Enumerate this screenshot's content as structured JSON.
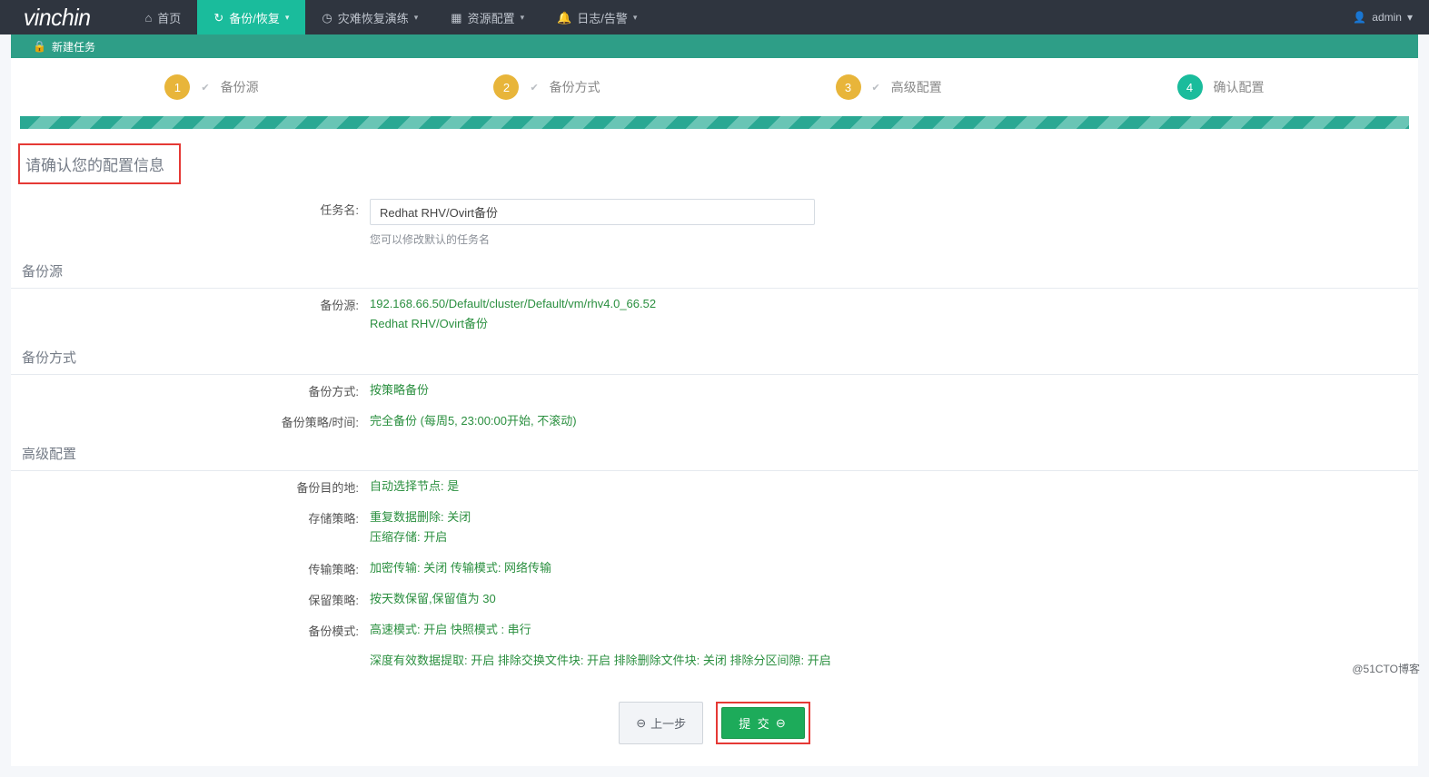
{
  "brand": "vinchin",
  "nav": {
    "home": {
      "label": "首页"
    },
    "backup": {
      "label": "备份/恢复"
    },
    "dr": {
      "label": "灾难恢复演练"
    },
    "resource": {
      "label": "资源配置"
    },
    "log": {
      "label": "日志/告警"
    }
  },
  "user": {
    "name": "admin"
  },
  "page_top": {
    "title": "新建任务"
  },
  "steps": {
    "s1": {
      "num": "1",
      "label": "备份源"
    },
    "s2": {
      "num": "2",
      "label": "备份方式"
    },
    "s3": {
      "num": "3",
      "label": "高级配置"
    },
    "s4": {
      "num": "4",
      "label": "确认配置"
    }
  },
  "confirm_title": "请确认您的配置信息",
  "task_name": {
    "label": "任务名:",
    "value": "Redhat RHV/Ovirt备份",
    "hint": "您可以修改默认的任务名"
  },
  "section_source": "备份源",
  "source": {
    "label": "备份源:",
    "value1": "192.168.66.50/Default/cluster/Default/vm/rhv4.0_66.52",
    "value2": "Redhat RHV/Ovirt备份"
  },
  "section_method": "备份方式",
  "method": {
    "label": "备份方式:",
    "value": "按策略备份"
  },
  "schedule": {
    "label": "备份策略/时间:",
    "value": "完全备份 (每周5, 23:00:00开始, 不滚动)"
  },
  "section_advanced": "高级配置",
  "dest": {
    "label": "备份目的地:",
    "value": "自动选择节点: 是"
  },
  "storage": {
    "label": "存储策略:",
    "value1": "重复数据删除: 关闭",
    "value2": "压缩存储: 开启"
  },
  "transfer": {
    "label": "传输策略:",
    "value": "加密传输: 关闭 传输模式: 网络传输"
  },
  "retention": {
    "label": "保留策略:",
    "value": "按天数保留,保留值为 30"
  },
  "mode": {
    "label": "备份模式:",
    "value": "高速模式: 开启 快照模式 : 串行"
  },
  "deep": {
    "label": "",
    "value": "深度有效数据提取: 开启 排除交换文件块: 开启 排除删除文件块: 关闭 排除分区间隙: 开启"
  },
  "actions": {
    "prev": "上一步",
    "submit": "提 交"
  },
  "watermark": "@51CTO博客"
}
